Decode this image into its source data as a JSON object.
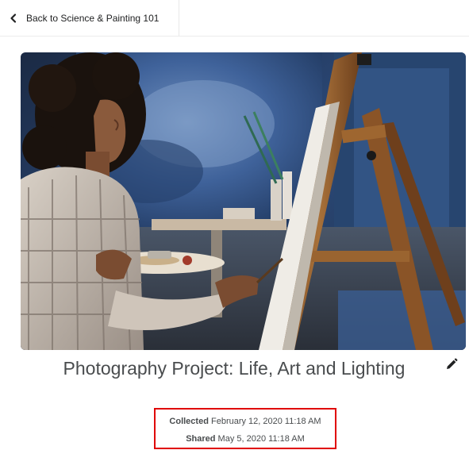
{
  "nav": {
    "back_label": "Back to Science & Painting 101"
  },
  "hero": {
    "alt": "Woman painting at an easel in a studio"
  },
  "post": {
    "title": "Photography Project: Life, Art and Lighting",
    "collected_label": "Collected",
    "collected_value": "February 12, 2020 11:18 AM",
    "shared_label": "Shared",
    "shared_value": "May 5, 2020 11:18 AM"
  },
  "icons": {
    "back": "chevron-left-icon",
    "edit": "pencil-icon"
  },
  "colors": {
    "highlight_border": "#e00000",
    "title_text": "#494c4e"
  }
}
